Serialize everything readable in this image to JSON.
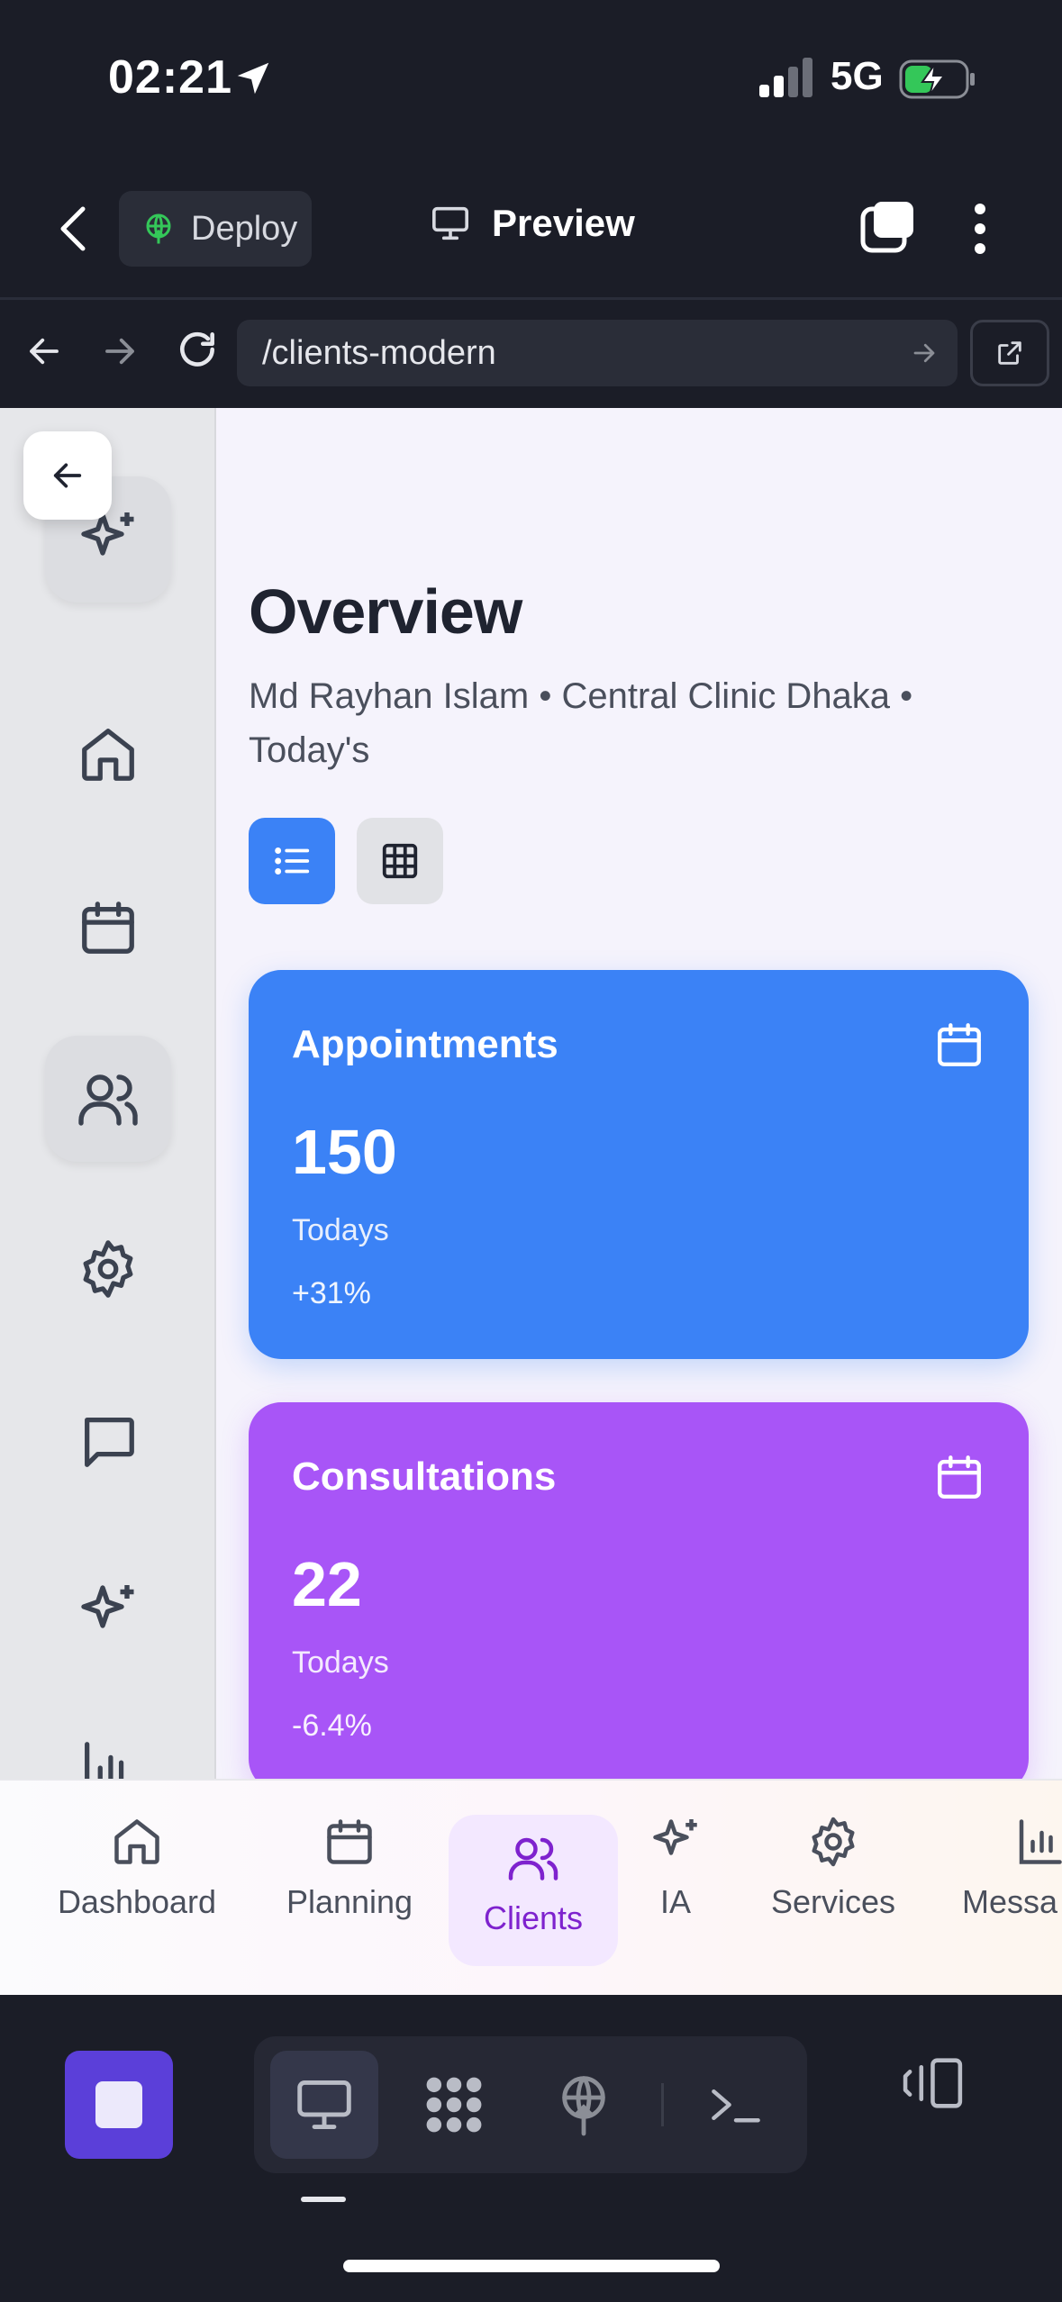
{
  "status_bar": {
    "time": "02:21",
    "network": "5G"
  },
  "app_bar": {
    "deploy_label": "Deploy",
    "preview_label": "Preview"
  },
  "url_bar": {
    "url": "/clients-modern"
  },
  "page": {
    "title": "Overview",
    "subtitle": "Md Rayhan Islam • Central Clinic Dhaka • Today's"
  },
  "side_rail": {
    "items": [
      {
        "icon": "sparkle-icon"
      },
      {
        "icon": "home-icon"
      },
      {
        "icon": "calendar-icon"
      },
      {
        "icon": "users-icon",
        "active": true
      },
      {
        "icon": "gear-icon"
      },
      {
        "icon": "message-icon"
      },
      {
        "icon": "sparkle-icon"
      }
    ]
  },
  "cards": [
    {
      "title": "Appointments",
      "value": "150",
      "caption": "Todays",
      "delta": "+31%",
      "color": "#3b82f6"
    },
    {
      "title": "Consultations",
      "value": "22",
      "caption": "Todays",
      "delta": "-6.4%",
      "color": "#a855f7"
    }
  ],
  "tabbar": {
    "items": [
      {
        "label": "Dashboard",
        "icon": "home-icon"
      },
      {
        "label": "Planning",
        "icon": "calendar-icon"
      },
      {
        "label": "Clients",
        "icon": "users-icon",
        "active": true
      },
      {
        "label": "IA",
        "icon": "sparkle-icon"
      },
      {
        "label": "Services",
        "icon": "gear-icon"
      },
      {
        "label": "Messa",
        "icon": "bar-chart-icon"
      }
    ]
  },
  "colors": {
    "accent_blue": "#3b82f6",
    "accent_purple": "#a855f7",
    "active_tab": "#7e22ce",
    "stop_button": "#5b3fd9"
  }
}
